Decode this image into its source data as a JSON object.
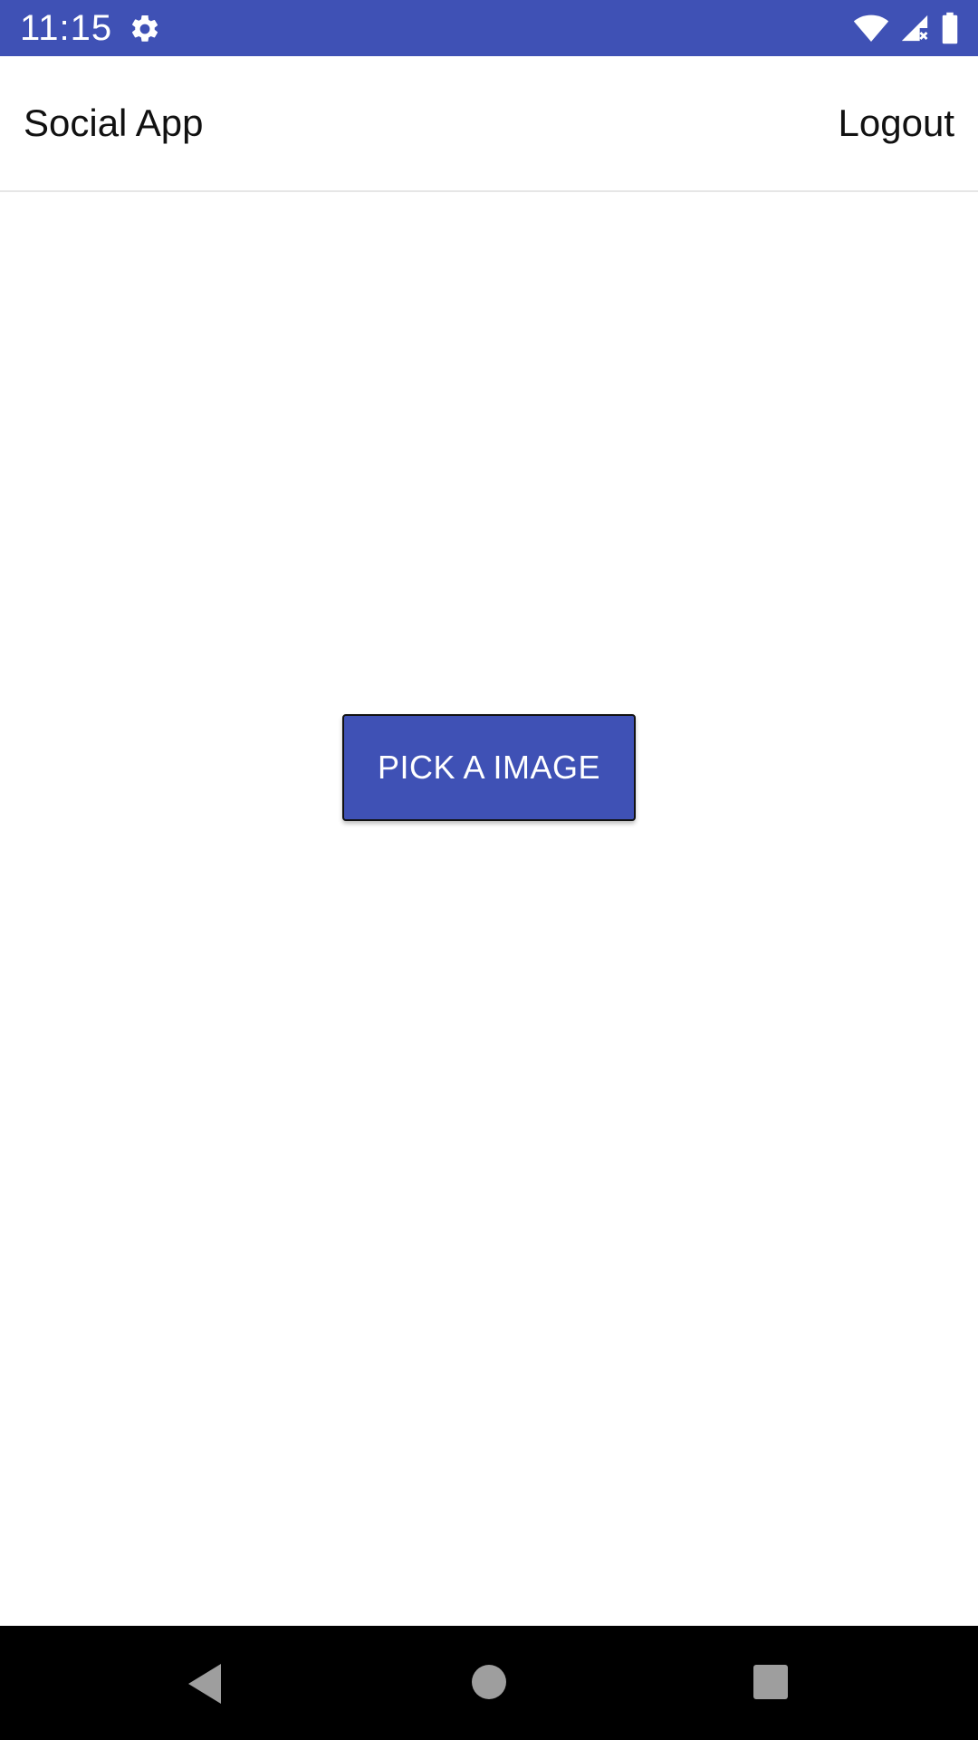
{
  "status_bar": {
    "time": "11:15",
    "icons": [
      "gear-icon",
      "wifi-icon",
      "signal-icon",
      "battery-icon"
    ],
    "background": "#3f51b5"
  },
  "app_bar": {
    "title": "Social App",
    "logout_label": "Logout"
  },
  "main": {
    "pick_button_label": "PICK A IMAGE",
    "button_color": "#3f51b5"
  },
  "nav_bar": {
    "icons": [
      "back-icon",
      "home-icon",
      "recents-icon"
    ]
  }
}
